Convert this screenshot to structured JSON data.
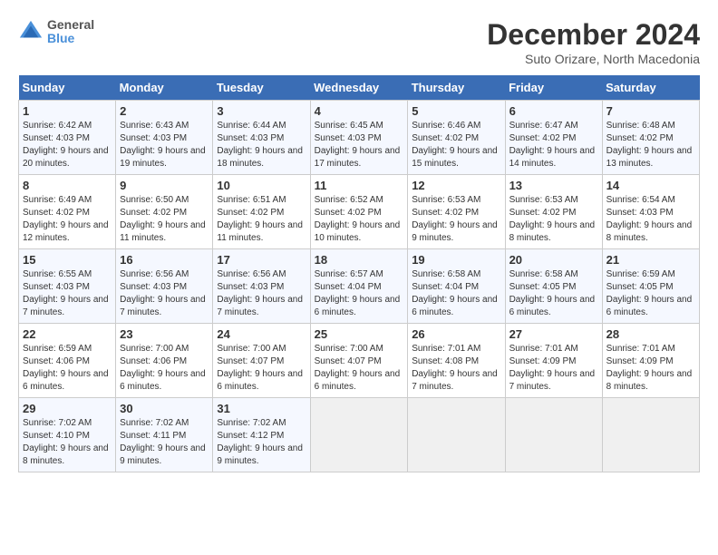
{
  "header": {
    "logo_line1": "General",
    "logo_line2": "Blue",
    "month_title": "December 2024",
    "subtitle": "Suto Orizare, North Macedonia"
  },
  "days_of_week": [
    "Sunday",
    "Monday",
    "Tuesday",
    "Wednesday",
    "Thursday",
    "Friday",
    "Saturday"
  ],
  "weeks": [
    [
      {
        "num": "1",
        "sunrise": "6:42 AM",
        "sunset": "4:03 PM",
        "daylight": "9 hours and 20 minutes."
      },
      {
        "num": "2",
        "sunrise": "6:43 AM",
        "sunset": "4:03 PM",
        "daylight": "9 hours and 19 minutes."
      },
      {
        "num": "3",
        "sunrise": "6:44 AM",
        "sunset": "4:03 PM",
        "daylight": "9 hours and 18 minutes."
      },
      {
        "num": "4",
        "sunrise": "6:45 AM",
        "sunset": "4:03 PM",
        "daylight": "9 hours and 17 minutes."
      },
      {
        "num": "5",
        "sunrise": "6:46 AM",
        "sunset": "4:02 PM",
        "daylight": "9 hours and 15 minutes."
      },
      {
        "num": "6",
        "sunrise": "6:47 AM",
        "sunset": "4:02 PM",
        "daylight": "9 hours and 14 minutes."
      },
      {
        "num": "7",
        "sunrise": "6:48 AM",
        "sunset": "4:02 PM",
        "daylight": "9 hours and 13 minutes."
      }
    ],
    [
      {
        "num": "8",
        "sunrise": "6:49 AM",
        "sunset": "4:02 PM",
        "daylight": "9 hours and 12 minutes."
      },
      {
        "num": "9",
        "sunrise": "6:50 AM",
        "sunset": "4:02 PM",
        "daylight": "9 hours and 11 minutes."
      },
      {
        "num": "10",
        "sunrise": "6:51 AM",
        "sunset": "4:02 PM",
        "daylight": "9 hours and 11 minutes."
      },
      {
        "num": "11",
        "sunrise": "6:52 AM",
        "sunset": "4:02 PM",
        "daylight": "9 hours and 10 minutes."
      },
      {
        "num": "12",
        "sunrise": "6:53 AM",
        "sunset": "4:02 PM",
        "daylight": "9 hours and 9 minutes."
      },
      {
        "num": "13",
        "sunrise": "6:53 AM",
        "sunset": "4:02 PM",
        "daylight": "9 hours and 8 minutes."
      },
      {
        "num": "14",
        "sunrise": "6:54 AM",
        "sunset": "4:03 PM",
        "daylight": "9 hours and 8 minutes."
      }
    ],
    [
      {
        "num": "15",
        "sunrise": "6:55 AM",
        "sunset": "4:03 PM",
        "daylight": "9 hours and 7 minutes."
      },
      {
        "num": "16",
        "sunrise": "6:56 AM",
        "sunset": "4:03 PM",
        "daylight": "9 hours and 7 minutes."
      },
      {
        "num": "17",
        "sunrise": "6:56 AM",
        "sunset": "4:03 PM",
        "daylight": "9 hours and 7 minutes."
      },
      {
        "num": "18",
        "sunrise": "6:57 AM",
        "sunset": "4:04 PM",
        "daylight": "9 hours and 6 minutes."
      },
      {
        "num": "19",
        "sunrise": "6:58 AM",
        "sunset": "4:04 PM",
        "daylight": "9 hours and 6 minutes."
      },
      {
        "num": "20",
        "sunrise": "6:58 AM",
        "sunset": "4:05 PM",
        "daylight": "9 hours and 6 minutes."
      },
      {
        "num": "21",
        "sunrise": "6:59 AM",
        "sunset": "4:05 PM",
        "daylight": "9 hours and 6 minutes."
      }
    ],
    [
      {
        "num": "22",
        "sunrise": "6:59 AM",
        "sunset": "4:06 PM",
        "daylight": "9 hours and 6 minutes."
      },
      {
        "num": "23",
        "sunrise": "7:00 AM",
        "sunset": "4:06 PM",
        "daylight": "9 hours and 6 minutes."
      },
      {
        "num": "24",
        "sunrise": "7:00 AM",
        "sunset": "4:07 PM",
        "daylight": "9 hours and 6 minutes."
      },
      {
        "num": "25",
        "sunrise": "7:00 AM",
        "sunset": "4:07 PM",
        "daylight": "9 hours and 6 minutes."
      },
      {
        "num": "26",
        "sunrise": "7:01 AM",
        "sunset": "4:08 PM",
        "daylight": "9 hours and 7 minutes."
      },
      {
        "num": "27",
        "sunrise": "7:01 AM",
        "sunset": "4:09 PM",
        "daylight": "9 hours and 7 minutes."
      },
      {
        "num": "28",
        "sunrise": "7:01 AM",
        "sunset": "4:09 PM",
        "daylight": "9 hours and 8 minutes."
      }
    ],
    [
      {
        "num": "29",
        "sunrise": "7:02 AM",
        "sunset": "4:10 PM",
        "daylight": "9 hours and 8 minutes."
      },
      {
        "num": "30",
        "sunrise": "7:02 AM",
        "sunset": "4:11 PM",
        "daylight": "9 hours and 9 minutes."
      },
      {
        "num": "31",
        "sunrise": "7:02 AM",
        "sunset": "4:12 PM",
        "daylight": "9 hours and 9 minutes."
      },
      null,
      null,
      null,
      null
    ]
  ]
}
